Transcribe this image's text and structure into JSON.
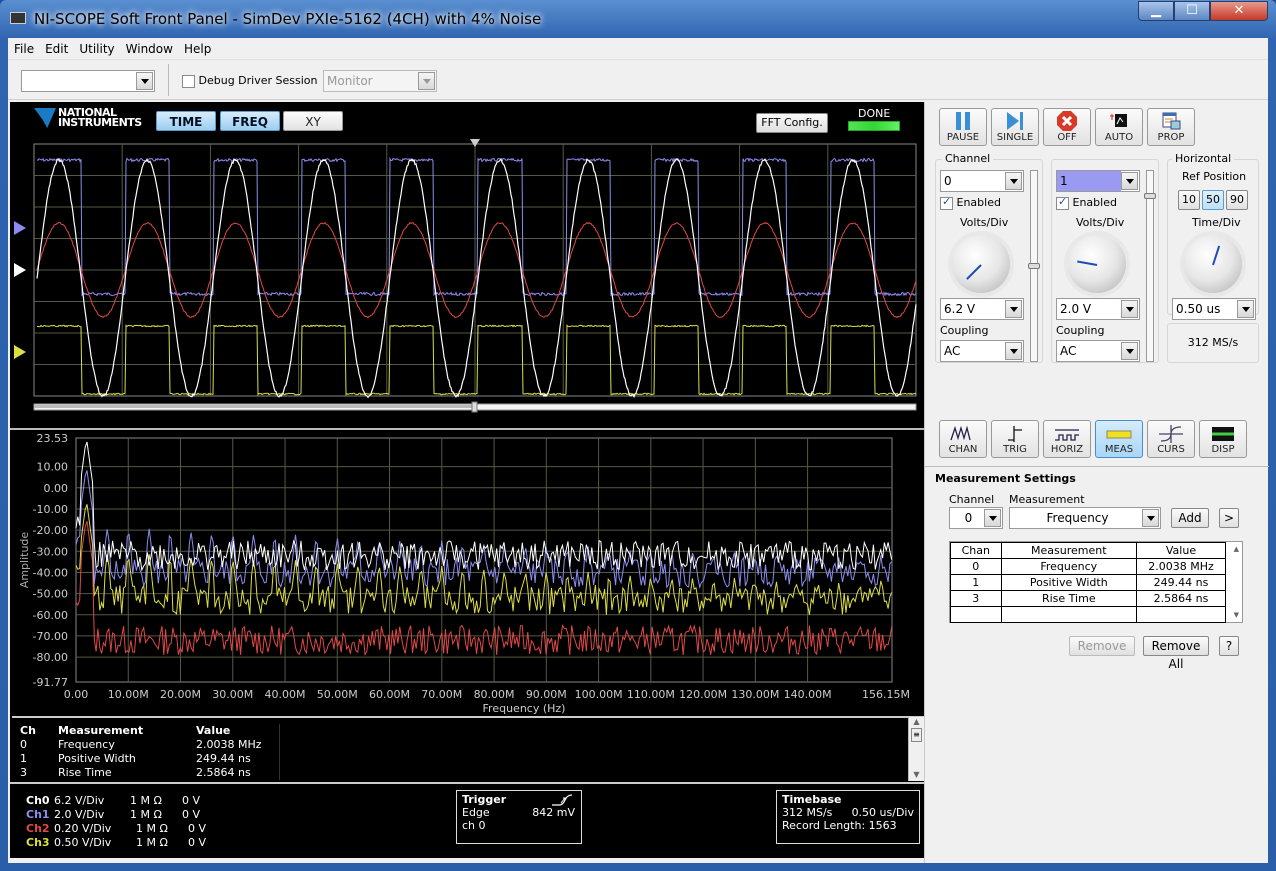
{
  "window": {
    "title": "NI-SCOPE Soft Front Panel - SimDev PXIe-5162 (4CH) with 4% Noise",
    "controls": {
      "minimize": "minimize",
      "maximize": "maximize",
      "close": "close"
    }
  },
  "menu": [
    "File",
    "Edit",
    "Utility",
    "Window",
    "Help"
  ],
  "toolbar": {
    "device_select_value": "",
    "debug_label": "Debug Driver Session",
    "debug_checked": false,
    "monitor_value": "Monitor"
  },
  "display": {
    "logo": [
      "NATIONAL",
      "INSTRUMENTS"
    ],
    "modes": [
      {
        "label": "TIME",
        "selected": true
      },
      {
        "label": "FREQ",
        "selected": true
      },
      {
        "label": "XY",
        "selected": false
      }
    ],
    "fft_config_label": "FFT Config.",
    "status_label": "DONE",
    "status_color": "#44dd44"
  },
  "channel_colors": {
    "ch0": "#ffffff",
    "ch1": "#8c8cf0",
    "ch2": "#e04848",
    "ch3": "#dddd44"
  },
  "time_plot": {
    "horizontal_divisions": 10,
    "vertical_divisions": 8,
    "periods_visible": 10,
    "trigger_position_fraction": 0.5,
    "scroll_position_fraction": 0.5,
    "channel_markers": [
      "ch1",
      "ch0",
      "ch3"
    ]
  },
  "chart_data": {
    "type": "line",
    "title": "",
    "xlabel": "Frequency (Hz)",
    "ylabel": "Amplitude",
    "ylim": [
      -91.77,
      23.53
    ],
    "xlim": [
      0,
      156.15
    ],
    "x_unit": "MHz",
    "y_ticks": [
      "23.53",
      "10.00",
      "0.00",
      "-10.00",
      "-20.00",
      "-30.00",
      "-40.00",
      "-50.00",
      "-60.00",
      "-70.00",
      "-80.00",
      "-91.77"
    ],
    "y_tick_values": [
      23.53,
      10,
      0,
      -10,
      -20,
      -30,
      -40,
      -50,
      -60,
      -70,
      -80,
      -91.77
    ],
    "x_ticks": [
      "0.00",
      "10.00M",
      "20.00M",
      "30.00M",
      "40.00M",
      "50.00M",
      "60.00M",
      "70.00M",
      "80.00M",
      "90.00M",
      "100.00M",
      "110.00M",
      "120.00M",
      "130.00M",
      "140.00M",
      "156.15M"
    ],
    "x_tick_values": [
      0,
      10,
      20,
      30,
      40,
      50,
      60,
      70,
      80,
      90,
      100,
      110,
      120,
      130,
      140,
      156.15
    ],
    "grid": true,
    "series": [
      {
        "name": "Ch0",
        "color": "#ffffff",
        "fundamental_mhz": 2.0,
        "peak_db": 23.5,
        "floor_db": -32
      },
      {
        "name": "Ch1",
        "color": "#8c8cf0",
        "fundamental_mhz": 2.0,
        "peak_db": 10,
        "harmonic_peak_db": -18,
        "floor_db": -40
      },
      {
        "name": "Ch2",
        "color": "#e04848",
        "fundamental_mhz": 2.0,
        "peak_db": -14,
        "floor_db": -72
      },
      {
        "name": "Ch3",
        "color": "#dddd44",
        "fundamental_mhz": 2.0,
        "peak_db": -6,
        "harmonic_peak_db": -30,
        "floor_db": -53
      }
    ]
  },
  "measurements_display": {
    "headers": [
      "Ch",
      "Measurement",
      "Value"
    ],
    "rows": [
      [
        "0",
        "Frequency",
        "2.0038 MHz"
      ],
      [
        "1",
        "Positive Width",
        "249.44 ns"
      ],
      [
        "3",
        "Rise Time",
        "2.5864 ns"
      ]
    ]
  },
  "channel_summary": [
    {
      "name": "Ch0",
      "vdiv": "6.2 V/Div",
      "impedance": "1 M Ω",
      "offset": "0 V"
    },
    {
      "name": "Ch1",
      "vdiv": "2.0 V/Div",
      "impedance": "1 M Ω",
      "offset": "0 V"
    },
    {
      "name": "Ch2",
      "vdiv": "0.20 V/Div",
      "impedance": "1 M Ω",
      "offset": "0 V"
    },
    {
      "name": "Ch3",
      "vdiv": "0.50 V/Div",
      "impedance": "1 M Ω",
      "offset": "0 V"
    }
  ],
  "trigger_box": {
    "title": "Trigger",
    "type": "Edge",
    "level": "842 mV",
    "source": "ch 0"
  },
  "timebase_box": {
    "title": "Timebase",
    "rate": "312 MS/s",
    "tdiv": "0.50 us/Div",
    "record_length": "Record Length: 1563"
  },
  "controls": {
    "buttons": [
      "PAUSE",
      "SINGLE",
      "OFF",
      "AUTO",
      "PROP"
    ],
    "channel_a": {
      "group_label": "Channel",
      "value": "0",
      "enabled_label": "Enabled",
      "enabled": true,
      "vdiv_label": "Volts/Div",
      "vdiv_value": "6.2 V",
      "coupling_label": "Coupling",
      "coupling_value": "AC",
      "slider_fraction": 0.5
    },
    "channel_b": {
      "value": "1",
      "enabled_label": "Enabled",
      "enabled": true,
      "vdiv_label": "Volts/Div",
      "vdiv_value": "2.0 V",
      "coupling_label": "Coupling",
      "coupling_value": "AC",
      "slider_fraction": 0.88
    },
    "horizontal": {
      "group_label": "Horizontal",
      "ref_label": "Ref Position",
      "ref_options": [
        "10",
        "50",
        "90"
      ],
      "ref_selected": "50",
      "tdiv_label": "Time/Div",
      "tdiv_value": "0.50 us",
      "sample_rate": "312 MS/s"
    },
    "tabs": [
      {
        "label": "CHAN"
      },
      {
        "label": "TRIG"
      },
      {
        "label": "HORIZ"
      },
      {
        "label": "MEAS",
        "selected": true
      },
      {
        "label": "CURS"
      },
      {
        "label": "DISP"
      }
    ]
  },
  "measurement_settings": {
    "title": "Measurement Settings",
    "channel_label": "Channel",
    "channel_value": "0",
    "measurement_label": "Measurement",
    "measurement_value": "Frequency",
    "add_label": "Add",
    "more_label": ">",
    "table_headers": [
      "Chan",
      "Measurement",
      "Value"
    ],
    "table_rows": [
      [
        "0",
        "Frequency",
        "2.0038 MHz"
      ],
      [
        "1",
        "Positive Width",
        "249.44 ns"
      ],
      [
        "3",
        "Rise Time",
        "2.5864 ns"
      ]
    ],
    "remove_label": "Remove",
    "remove_all_label": "Remove All",
    "help_label": "?"
  }
}
